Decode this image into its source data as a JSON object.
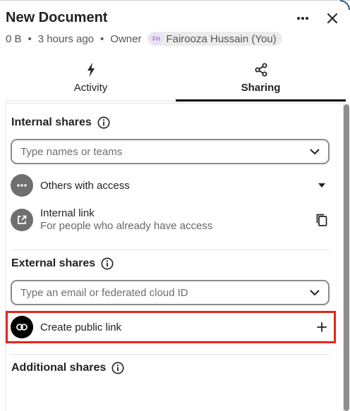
{
  "header": {
    "title": "New Document",
    "size": "0 B",
    "modified": "3 hours ago",
    "role": "Owner",
    "owner_initials": "FH",
    "owner_name": "Fairooza Hussain (You)",
    "more_icon": "more-horizontal-icon",
    "close_icon": "close-icon"
  },
  "tabs": [
    {
      "label": "Activity",
      "icon": "lightning-icon",
      "active": false
    },
    {
      "label": "Sharing",
      "icon": "share-icon",
      "active": true
    }
  ],
  "internal": {
    "heading": "Internal shares",
    "search_placeholder": "Type names or teams",
    "others_label": "Others with access",
    "link_title": "Internal link",
    "link_subtitle": "For people who already have access"
  },
  "external": {
    "heading": "External shares",
    "search_placeholder": "Type an email or federated cloud ID",
    "public_link_label": "Create public link"
  },
  "additional": {
    "heading": "Additional shares"
  },
  "colors": {
    "highlight": "#e5261b",
    "active_tab_underline": "#000000",
    "owner_avatar_text": "#7a5aa6"
  }
}
